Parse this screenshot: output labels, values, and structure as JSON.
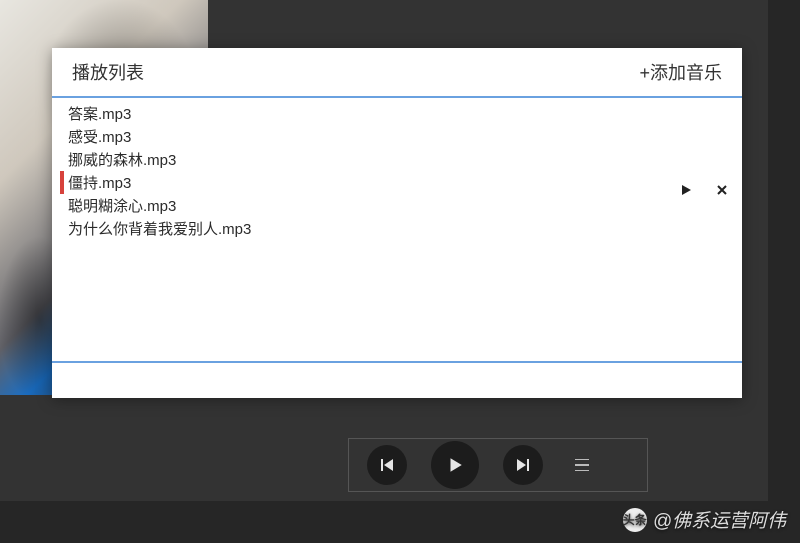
{
  "panel": {
    "title": "播放列表",
    "add_label": "+添加音乐"
  },
  "playlist": {
    "selected_index": 3,
    "items": [
      {
        "name": "答案.mp3"
      },
      {
        "name": "感受.mp3"
      },
      {
        "name": "挪威的森林.mp3"
      },
      {
        "name": "僵持.mp3"
      },
      {
        "name": "聪明糊涂心.mp3"
      },
      {
        "name": "为什么你背着我爱别人.mp3"
      }
    ]
  },
  "icons": {
    "row_play": "play-icon",
    "row_remove": "close-icon",
    "prev": "previous-icon",
    "play": "play-icon",
    "next": "next-icon",
    "menu": "menu-icon"
  },
  "watermark": {
    "logo_text": "头条",
    "text": "@佛系运营阿伟"
  },
  "colors": {
    "accent_line": "#6aa1e0",
    "selected_marker": "#d7423c",
    "bg_outer": "#262626",
    "bg_inner": "#333333",
    "panel_bg": "#ffffff"
  }
}
